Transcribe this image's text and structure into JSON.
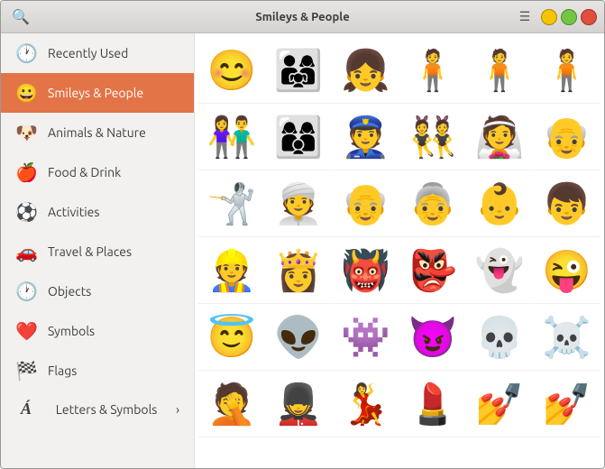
{
  "window": {
    "title": "Smileys & People"
  },
  "sidebar": {
    "items": [
      {
        "id": "recently-used",
        "label": "Recently Used",
        "icon": "🕐",
        "active": false
      },
      {
        "id": "smileys-people",
        "label": "Smileys & People",
        "icon": "😀",
        "active": true
      },
      {
        "id": "animals-nature",
        "label": "Animals & Nature",
        "icon": "🐶",
        "active": false
      },
      {
        "id": "food-drink",
        "label": "Food & Drink",
        "icon": "🍎",
        "active": false
      },
      {
        "id": "activities",
        "label": "Activities",
        "icon": "⚽",
        "active": false
      },
      {
        "id": "travel-places",
        "label": "Travel & Places",
        "icon": "🚗",
        "active": false
      },
      {
        "id": "objects",
        "label": "Objects",
        "icon": "🕐",
        "active": false
      },
      {
        "id": "symbols",
        "label": "Symbols",
        "icon": "❤️",
        "active": false
      },
      {
        "id": "flags",
        "label": "Flags",
        "icon": "🏁",
        "active": false
      },
      {
        "id": "letters-symbols",
        "label": "Letters & Symbols",
        "icon": "Á",
        "active": false
      }
    ]
  },
  "emojis": [
    "👨‍👩‍👧",
    "👩‍👩‍👦",
    "👮",
    "👯",
    "👰",
    "👴",
    "🤺",
    "👳",
    "👴",
    "👵",
    "👶",
    "🧒",
    "👷",
    "👸",
    "👹",
    "👺",
    "👻",
    "😜",
    "😇",
    "👽",
    "👾",
    "😈",
    "💀",
    "💀",
    "🤦",
    "💂",
    "💃",
    "💄",
    "💅",
    "💅"
  ]
}
